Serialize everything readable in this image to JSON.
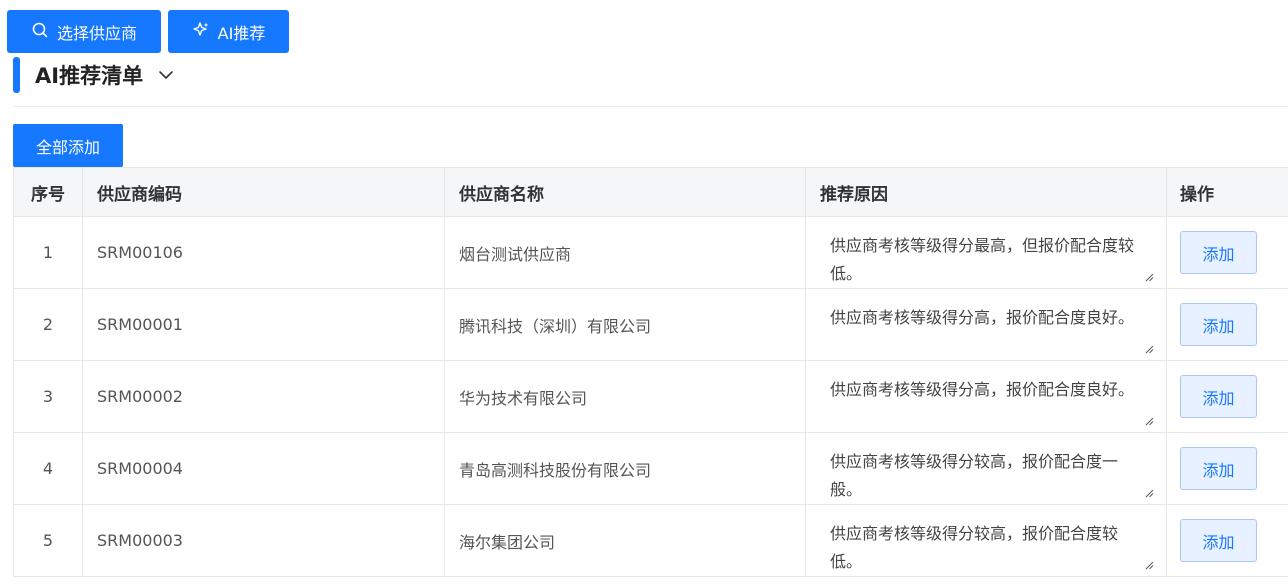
{
  "toolbar": {
    "select_supplier_label": "选择供应商",
    "ai_recommend_label": "AI推荐"
  },
  "section": {
    "title": "AI推荐清单"
  },
  "add_all_label": "全部添加",
  "table": {
    "headers": {
      "index": "序号",
      "code": "供应商编码",
      "name": "供应商名称",
      "reason": "推荐原因",
      "action": "操作"
    },
    "rows": [
      {
        "index": "1",
        "code": "SRM00106",
        "name": "烟台测试供应商",
        "reason": "供应商考核等级得分最高，但报价配合度较低。",
        "action": "添加"
      },
      {
        "index": "2",
        "code": "SRM00001",
        "name": "腾讯科技（深圳）有限公司",
        "reason": "供应商考核等级得分高，报价配合度良好。",
        "action": "添加"
      },
      {
        "index": "3",
        "code": "SRM00002",
        "name": "华为技术有限公司",
        "reason": "供应商考核等级得分高，报价配合度良好。",
        "action": "添加"
      },
      {
        "index": "4",
        "code": "SRM00004",
        "name": "青岛高测科技股份有限公司",
        "reason": "供应商考核等级得分较高，报价配合度一般。",
        "action": "添加"
      },
      {
        "index": "5",
        "code": "SRM00003",
        "name": "海尔集团公司",
        "reason": "供应商考核等级得分较高，报价配合度较低。",
        "action": "添加"
      }
    ]
  },
  "colors": {
    "primary": "#1677ff",
    "header_bg": "#f5f6f8",
    "add_button_bg": "#e8f1ff"
  },
  "icons": {
    "select_supplier": "search-icon",
    "ai_recommend": "sparkle-icon",
    "section_toggle": "chevron-down-icon"
  }
}
